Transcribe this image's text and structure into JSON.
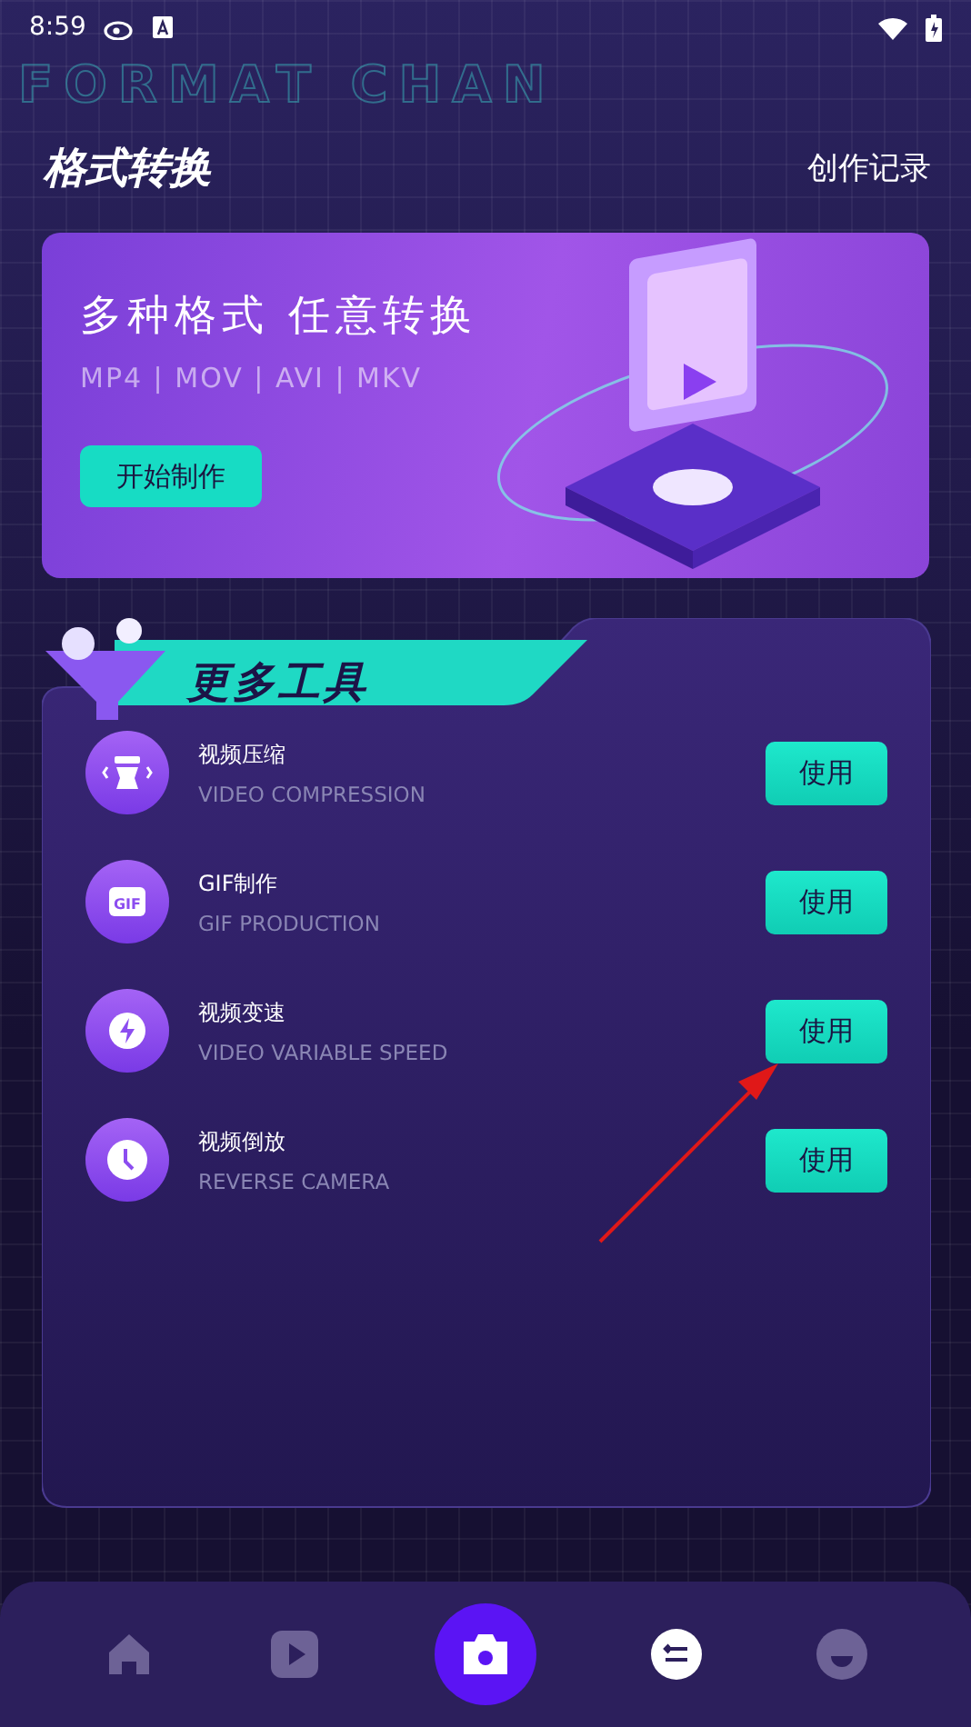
{
  "status_bar": {
    "time": "8:59"
  },
  "header": {
    "backdrop_text": "FORMAT CHAN",
    "title": "格式转换",
    "link": "创作记录"
  },
  "banner": {
    "title": "多种格式 任意转换",
    "formats": "MP4 | MOV | AVI | MKV",
    "button": "开始制作"
  },
  "tools": {
    "title": "更多工具",
    "items": [
      {
        "kind": "compress",
        "name": "视频压缩",
        "subtitle": "VIDEO COMPRESSION",
        "button": "使用"
      },
      {
        "kind": "gif",
        "icon_label": "GIF",
        "name": "GIF制作",
        "subtitle": "GIF PRODUCTION",
        "button": "使用"
      },
      {
        "kind": "speed",
        "name": "视频变速",
        "subtitle": "VIDEO VARIABLE SPEED",
        "button": "使用"
      },
      {
        "kind": "reverse",
        "name": "视频倒放",
        "subtitle": "REVERSE CAMERA",
        "button": "使用"
      }
    ]
  },
  "bottom_nav": [
    {
      "kind": "home",
      "selected": false
    },
    {
      "kind": "play",
      "selected": false
    },
    {
      "kind": "camera",
      "selected": false
    },
    {
      "kind": "convert",
      "selected": true
    },
    {
      "kind": "profile",
      "selected": false
    }
  ]
}
